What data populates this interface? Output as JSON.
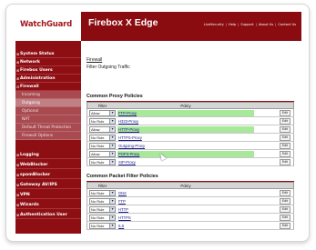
{
  "brand": {
    "logo_text": "WatchGuard",
    "product": "Firebox X Edge"
  },
  "top_links": [
    "LiveSecurity",
    "Help",
    "Support",
    "About Us",
    "Contact Us"
  ],
  "sidebar": {
    "items": [
      {
        "label": "System Status"
      },
      {
        "label": "Network"
      },
      {
        "label": "Firebox Users"
      },
      {
        "label": "Administration"
      },
      {
        "label": "Firewall"
      },
      {
        "label": "Logging"
      },
      {
        "label": "WebBlocker"
      },
      {
        "label": "spamBlocker"
      },
      {
        "label": "Gateway AV/IPS"
      },
      {
        "label": "VPN"
      },
      {
        "label": "Wizards"
      },
      {
        "label": "Authentication User"
      }
    ],
    "firewall_subitems": [
      {
        "label": "Incoming"
      },
      {
        "label": "Outgoing"
      },
      {
        "label": "Optional"
      },
      {
        "label": "NAT"
      },
      {
        "label": "Default Threat Protection"
      },
      {
        "label": "Firewall Options"
      }
    ],
    "active_subitem": "Outgoing"
  },
  "content": {
    "breadcrumb": "Firewall",
    "page_title": "Filter Outgoing Traffic",
    "proxy_section": {
      "title": "Common Proxy Policies",
      "col_filter": "Filter",
      "col_policy": "Policy",
      "rows": [
        {
          "filter": "Allow",
          "policy": "FTP-Proxy",
          "edit": "Edit"
        },
        {
          "filter": "No Rule",
          "policy": "H323-Proxy",
          "edit": "Edit"
        },
        {
          "filter": "Allow",
          "policy": "HTTP-Proxy",
          "edit": "Edit"
        },
        {
          "filter": "No Rule",
          "policy": "HTTPS-Proxy",
          "edit": "Edit"
        },
        {
          "filter": "No Rule",
          "policy": "Outgoing-Proxy",
          "edit": "Edit"
        },
        {
          "filter": "Allow",
          "policy": "POP3-Proxy",
          "edit": "Edit"
        },
        {
          "filter": "No Rule",
          "policy": "SIP-Proxy",
          "edit": "Edit"
        }
      ]
    },
    "packet_section": {
      "title": "Common Packet Filter Policies",
      "col_filter": "Filter",
      "col_policy": "Policy",
      "rows": [
        {
          "filter": "No Rule",
          "policy": "DNS",
          "edit": "Edit"
        },
        {
          "filter": "No Rule",
          "policy": "FTP",
          "edit": "Edit"
        },
        {
          "filter": "No Rule",
          "policy": "HTTP",
          "edit": "Edit"
        },
        {
          "filter": "No Rule",
          "policy": "HTTPS",
          "edit": "Edit"
        },
        {
          "filter": "No Rule",
          "policy": "ILS",
          "edit": "Edit"
        }
      ]
    }
  },
  "colors": {
    "brand_red": "#8a0c10",
    "enabled_row_highlight": "#a8e89a",
    "sub_nav_bg": "#a84a4f"
  }
}
